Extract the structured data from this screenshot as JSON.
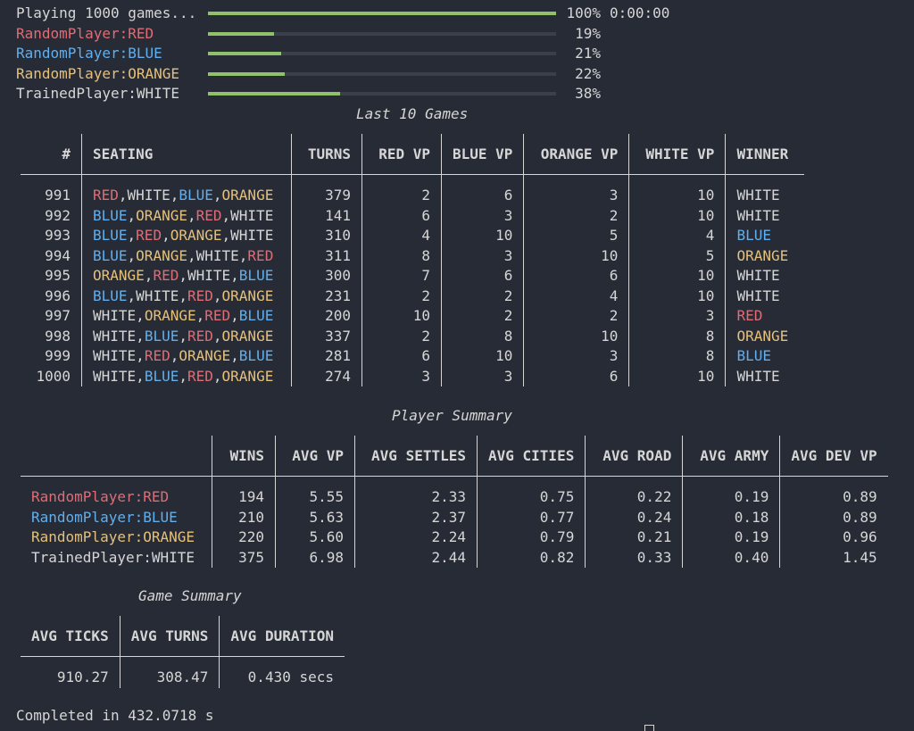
{
  "progress": [
    {
      "label": "Playing 1000 games...",
      "color": "#d6d6d6",
      "percent": 100,
      "percent_text": "100%",
      "time": "0:00:00"
    },
    {
      "label": "RandomPlayer:RED",
      "color": "#e06c75",
      "percent": 19,
      "percent_text": "19%"
    },
    {
      "label": "RandomPlayer:BLUE",
      "color": "#61afef",
      "percent": 21,
      "percent_text": "21%"
    },
    {
      "label": "RandomPlayer:ORANGE",
      "color": "#e5c07b",
      "percent": 22,
      "percent_text": "22%"
    },
    {
      "label": "TrainedPlayer:WHITE",
      "color": "#d6d6d6",
      "percent": 38,
      "percent_text": "38%"
    }
  ],
  "last_games": {
    "title": "Last 10 Games",
    "headers": [
      "#",
      "SEATING",
      "TURNS",
      "RED VP",
      "BLUE VP",
      "ORANGE VP",
      "WHITE VP",
      "WINNER"
    ],
    "rows": [
      {
        "n": "991",
        "seating": [
          "RED",
          "WHITE",
          "BLUE",
          "ORANGE"
        ],
        "turns": "379",
        "red": "2",
        "blue": "6",
        "orange": "3",
        "white": "10",
        "winner": "WHITE"
      },
      {
        "n": "992",
        "seating": [
          "BLUE",
          "ORANGE",
          "RED",
          "WHITE"
        ],
        "turns": "141",
        "red": "6",
        "blue": "3",
        "orange": "2",
        "white": "10",
        "winner": "WHITE"
      },
      {
        "n": "993",
        "seating": [
          "BLUE",
          "RED",
          "ORANGE",
          "WHITE"
        ],
        "turns": "310",
        "red": "4",
        "blue": "10",
        "orange": "5",
        "white": "4",
        "winner": "BLUE"
      },
      {
        "n": "994",
        "seating": [
          "BLUE",
          "ORANGE",
          "WHITE",
          "RED"
        ],
        "turns": "311",
        "red": "8",
        "blue": "3",
        "orange": "10",
        "white": "5",
        "winner": "ORANGE"
      },
      {
        "n": "995",
        "seating": [
          "ORANGE",
          "RED",
          "WHITE",
          "BLUE"
        ],
        "turns": "300",
        "red": "7",
        "blue": "6",
        "orange": "6",
        "white": "10",
        "winner": "WHITE"
      },
      {
        "n": "996",
        "seating": [
          "BLUE",
          "WHITE",
          "RED",
          "ORANGE"
        ],
        "turns": "231",
        "red": "2",
        "blue": "2",
        "orange": "4",
        "white": "10",
        "winner": "WHITE"
      },
      {
        "n": "997",
        "seating": [
          "WHITE",
          "ORANGE",
          "RED",
          "BLUE"
        ],
        "turns": "200",
        "red": "10",
        "blue": "2",
        "orange": "2",
        "white": "3",
        "winner": "RED"
      },
      {
        "n": "998",
        "seating": [
          "WHITE",
          "BLUE",
          "RED",
          "ORANGE"
        ],
        "turns": "337",
        "red": "2",
        "blue": "8",
        "orange": "10",
        "white": "8",
        "winner": "ORANGE"
      },
      {
        "n": "999",
        "seating": [
          "WHITE",
          "RED",
          "ORANGE",
          "BLUE"
        ],
        "turns": "281",
        "red": "6",
        "blue": "10",
        "orange": "3",
        "white": "8",
        "winner": "BLUE"
      },
      {
        "n": "1000",
        "seating": [
          "WHITE",
          "BLUE",
          "RED",
          "ORANGE"
        ],
        "turns": "274",
        "red": "3",
        "blue": "3",
        "orange": "6",
        "white": "10",
        "winner": "WHITE"
      }
    ]
  },
  "player_summary": {
    "title": "Player Summary",
    "headers": [
      "",
      "WINS",
      "AVG VP",
      "AVG SETTLES",
      "AVG CITIES",
      "AVG ROAD",
      "AVG ARMY",
      "AVG DEV VP"
    ],
    "rows": [
      {
        "player": "RandomPlayer:RED",
        "color": "RED",
        "values": [
          "194",
          "5.55",
          "2.33",
          "0.75",
          "0.22",
          "0.19",
          "0.89"
        ]
      },
      {
        "player": "RandomPlayer:BLUE",
        "color": "BLUE",
        "values": [
          "210",
          "5.63",
          "2.37",
          "0.77",
          "0.24",
          "0.18",
          "0.89"
        ]
      },
      {
        "player": "RandomPlayer:ORANGE",
        "color": "ORANGE",
        "values": [
          "220",
          "5.60",
          "2.24",
          "0.79",
          "0.21",
          "0.19",
          "0.96"
        ]
      },
      {
        "player": "TrainedPlayer:WHITE",
        "color": "WHITE",
        "values": [
          "375",
          "6.98",
          "2.44",
          "0.82",
          "0.33",
          "0.40",
          "1.45"
        ]
      }
    ]
  },
  "game_summary": {
    "title": "Game Summary",
    "headers": [
      "AVG TICKS",
      "AVG TURNS",
      "AVG DURATION"
    ],
    "values": [
      "910.27",
      "308.47",
      "0.430 secs"
    ]
  },
  "completed": "Completed in 432.0718 s",
  "colors": {
    "RED": "#e06c75",
    "BLUE": "#61afef",
    "ORANGE": "#e5c07b",
    "WHITE": "#d6d6d6",
    "bar_fill": "#8fc26b",
    "background": "#262b35"
  }
}
